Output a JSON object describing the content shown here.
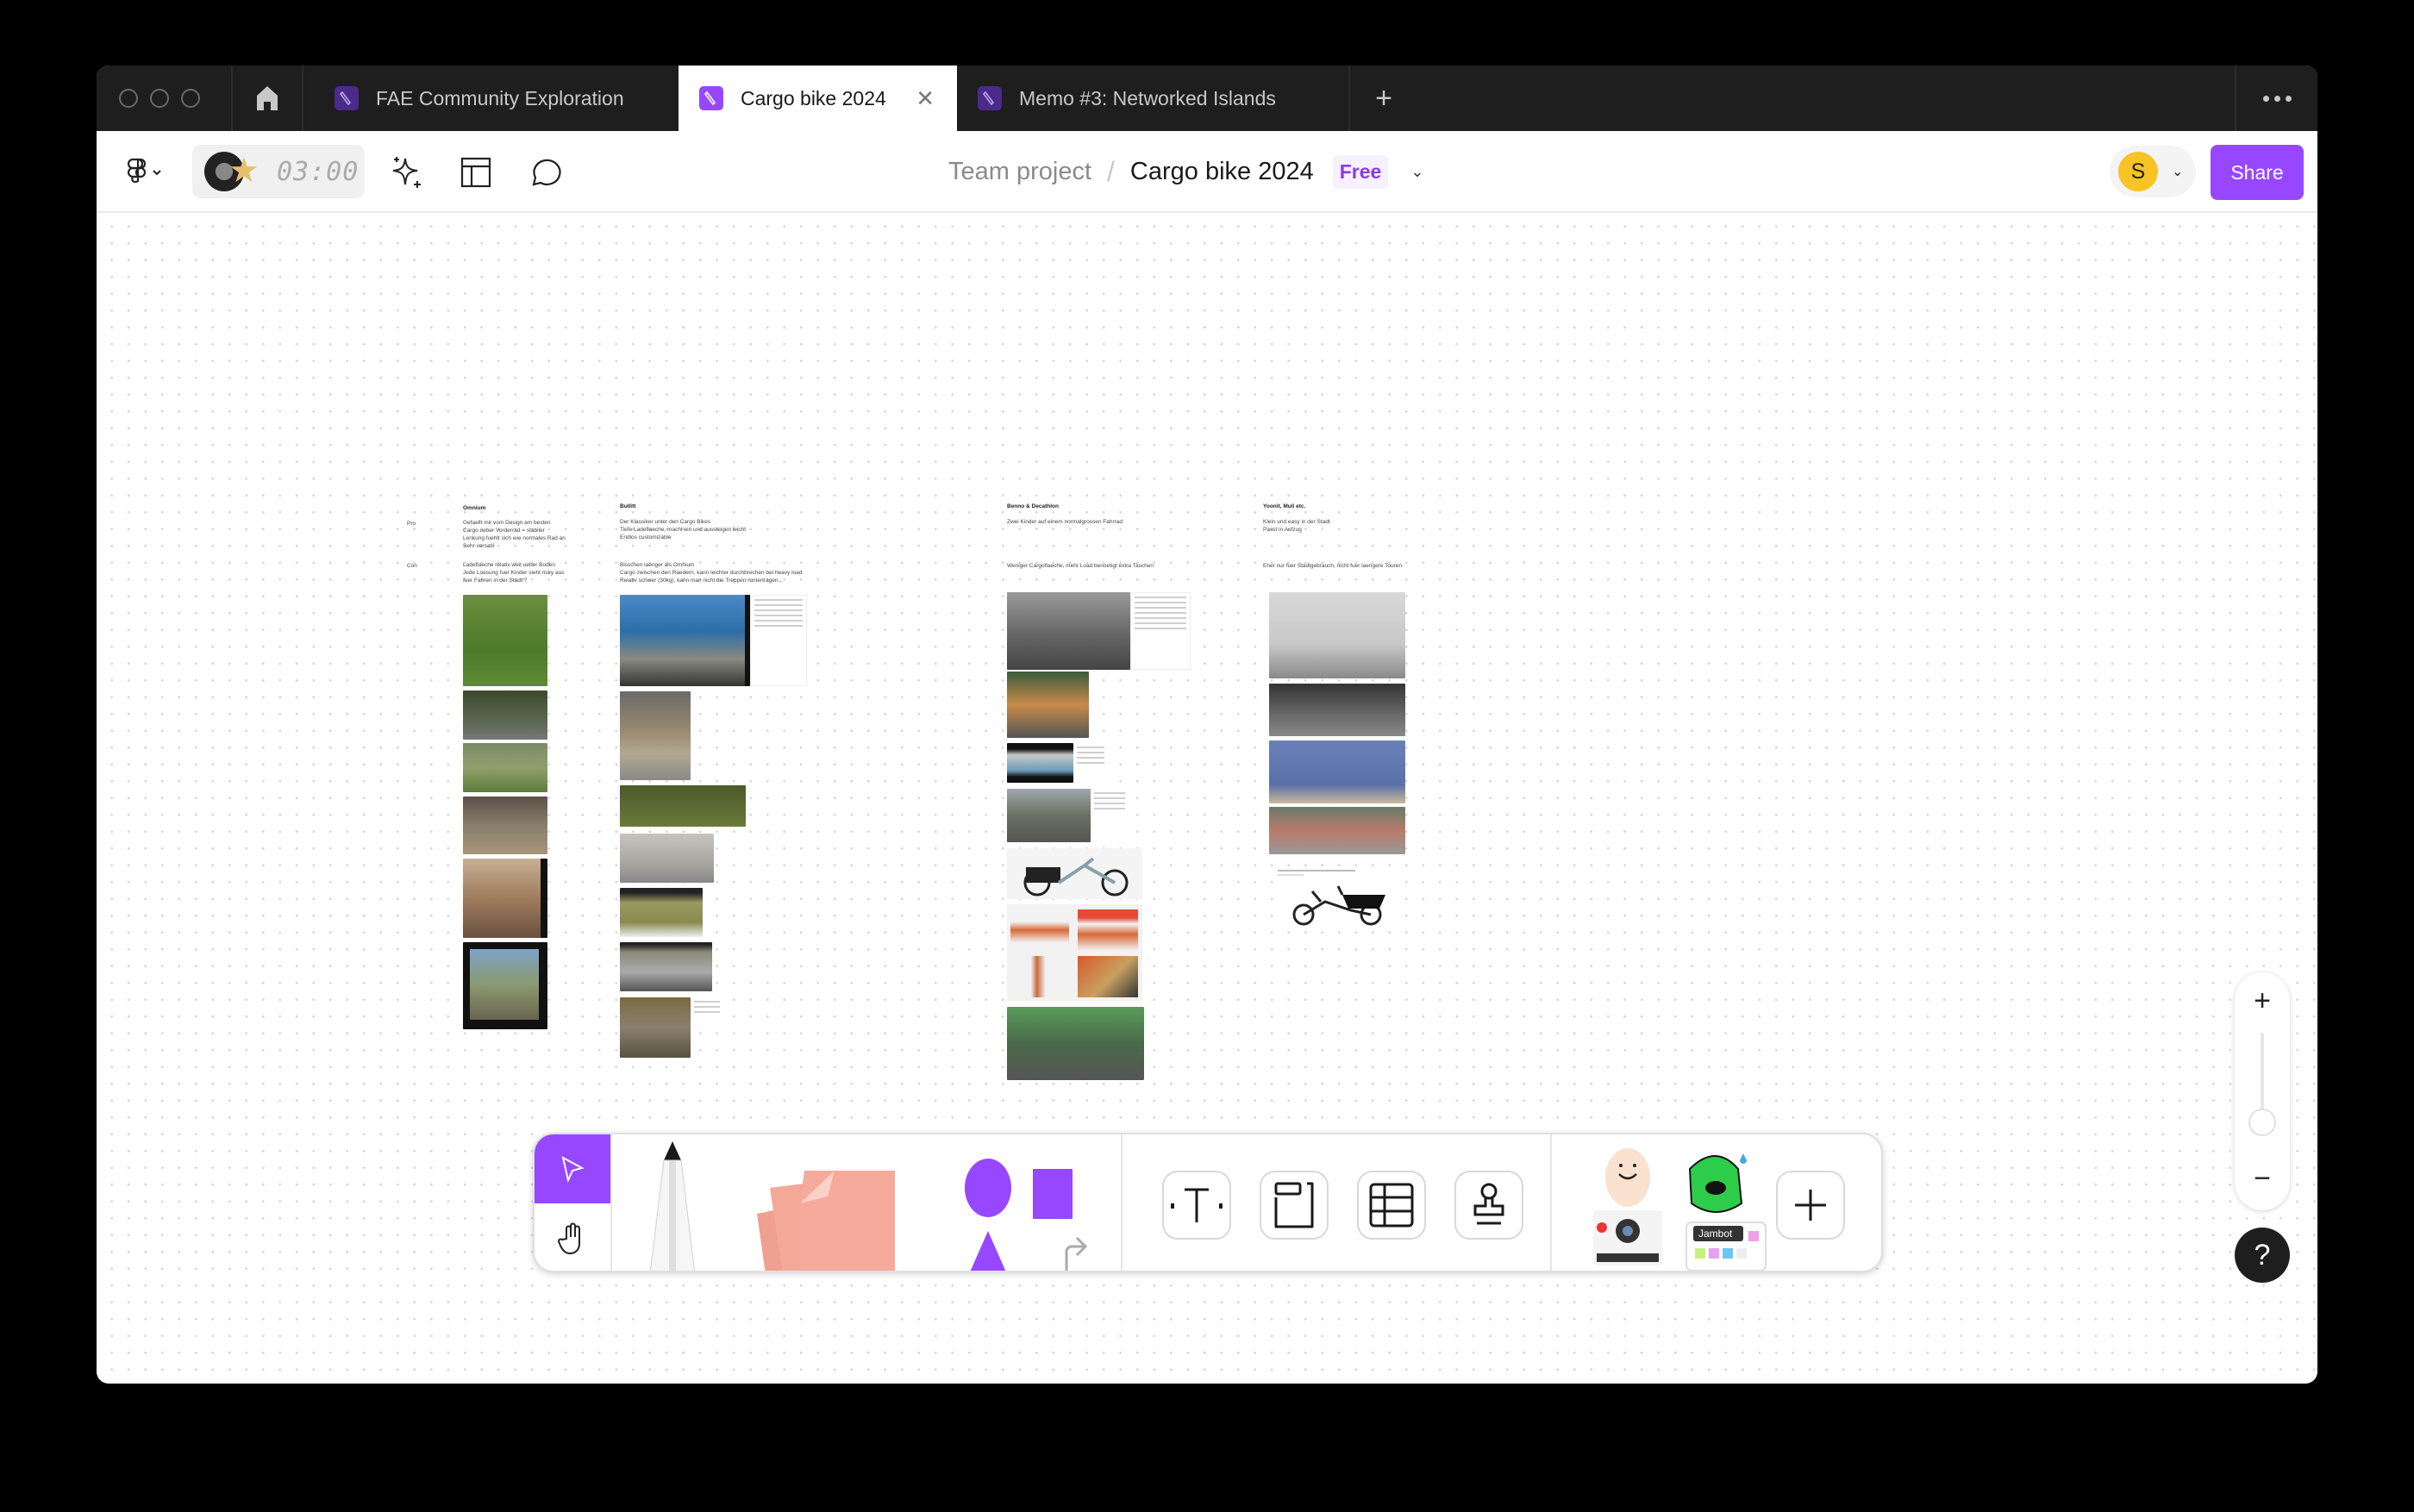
{
  "tabbar": {
    "tabs": [
      {
        "label": "FAE Community Exploration",
        "active": false
      },
      {
        "label": "Cargo bike 2024",
        "active": true
      },
      {
        "label": "Memo #3: Networked Islands",
        "active": false
      }
    ],
    "new_tab_label": "+",
    "close_label": "✕"
  },
  "header": {
    "timer": "03:00",
    "breadcrumb": {
      "team": "Team project",
      "separator": "/",
      "file": "Cargo bike 2024"
    },
    "plan_badge": "Free",
    "user_initial": "S",
    "share_label": "Share",
    "accent_color": "#9747ff"
  },
  "canvas": {
    "row_labels": {
      "pro": "Pro",
      "con": "Con"
    },
    "columns": [
      {
        "title": "Omnium",
        "pro": [
          "Gefaellt mir vom Design am besten",
          "Cargo ueber Vorderrad = stabiler",
          "Lenkung fuehlt sich wie normales Rad an",
          "Sehr versatil"
        ],
        "con": [
          "Ladeflaeche relativ weit ueber Boden",
          "Jede Loesung fuer Kinder sieht risky aus",
          "fuer Fahren in der Stadt!?"
        ]
      },
      {
        "title": "Bullitt",
        "pro": [
          "Der Klassiker unter den Cargo Bikes",
          "Tiefe Ladeflaeche, macht ein und aussteigen leicht",
          "Endlos customizable"
        ],
        "con": [
          "Bisschen laenger als Omnium",
          "Cargo zwischen den Raedern, kann leichter durchbrechen bei heavy load",
          "Relativ schwer (30kg), kann man nicht die Treppen runtertragen..."
        ]
      },
      {
        "title": "Benno & Decathlon",
        "pro": [
          "Zwei Kinder auf einem normalgrossen Fahrrad"
        ],
        "con": [
          "Weniger Cargoflaeche, mehr Load benoetigt extra Taschen"
        ]
      },
      {
        "title": "Yoonit, Muli etc.",
        "pro": [
          "Klein und easy in der Stadt",
          "Passt in Aufzug"
        ],
        "con": [
          "Eher nur fuer Stadtgebrauch, nicht fuer laengere Touren"
        ]
      }
    ]
  },
  "toolbar": {
    "tools": [
      "select",
      "hand",
      "marker",
      "sticky-note",
      "shapes",
      "connector",
      "text",
      "section",
      "table",
      "stamp",
      "stickers",
      "more"
    ],
    "sticker_label": "Jambot",
    "add_label": "+"
  },
  "zoom_controls": {
    "zoom_in": "+",
    "zoom_out": "−",
    "level_fraction": 0.2,
    "help": "?"
  }
}
